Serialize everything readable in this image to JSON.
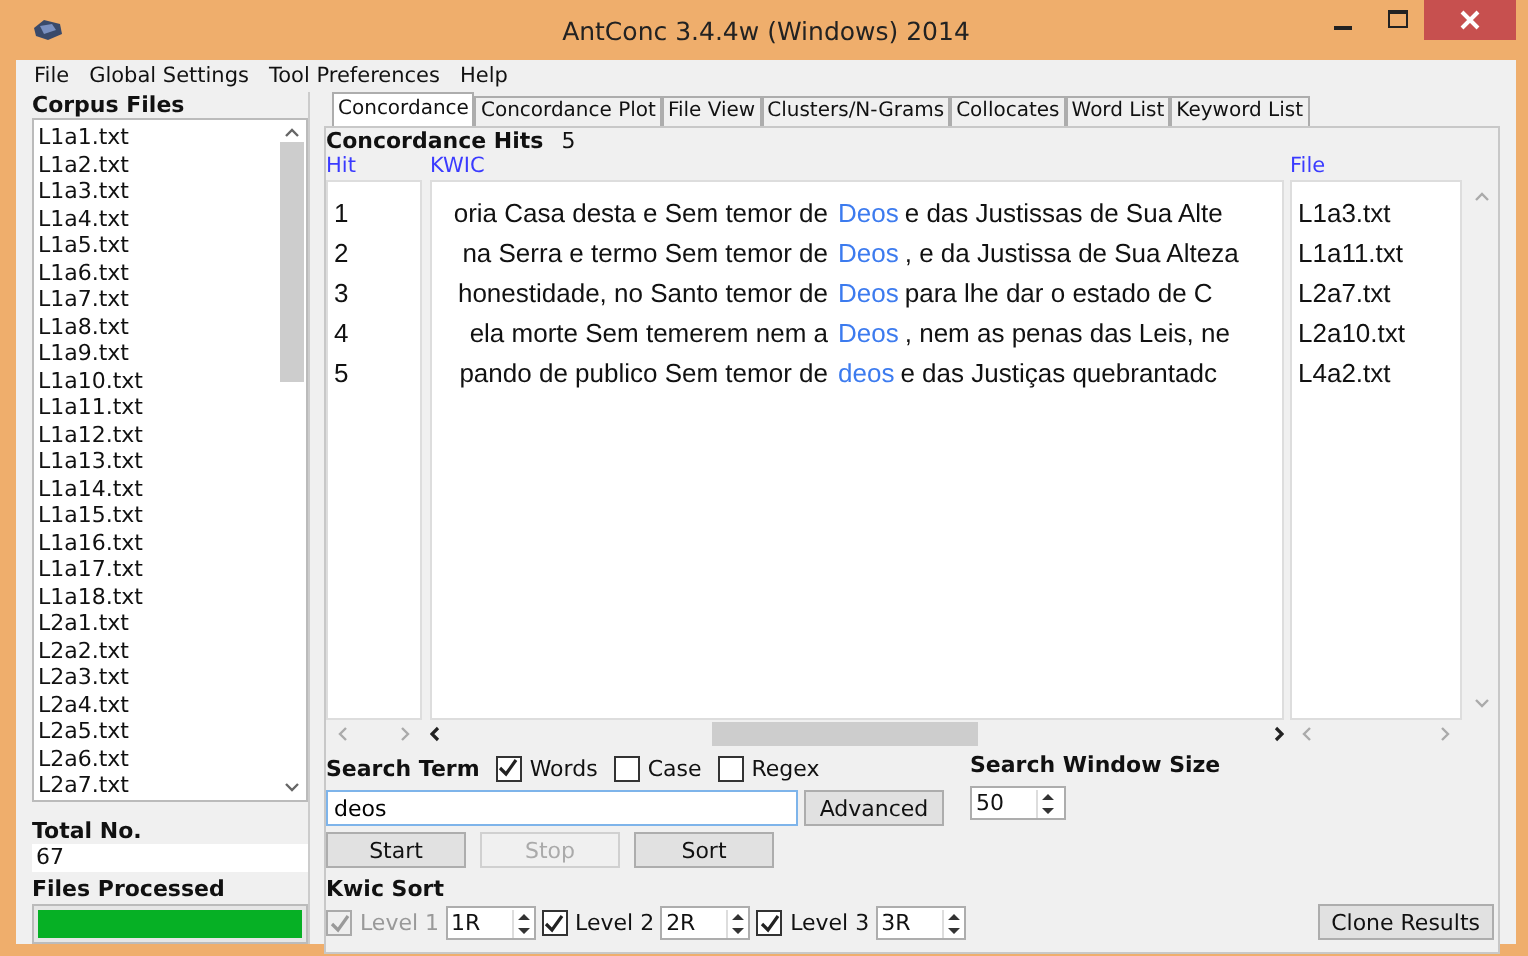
{
  "window": {
    "title": "AntConc 3.4.4w (Windows) 2014"
  },
  "menu": [
    "File",
    "Global Settings",
    "Tool Preferences",
    "Help"
  ],
  "corpus_files": {
    "title": "Corpus Files",
    "items": [
      "L1a1.txt",
      "L1a2.txt",
      "L1a3.txt",
      "L1a4.txt",
      "L1a5.txt",
      "L1a6.txt",
      "L1a7.txt",
      "L1a8.txt",
      "L1a9.txt",
      "L1a10.txt",
      "L1a11.txt",
      "L1a12.txt",
      "L1a13.txt",
      "L1a14.txt",
      "L1a15.txt",
      "L1a16.txt",
      "L1a17.txt",
      "L1a18.txt",
      "L2a1.txt",
      "L2a2.txt",
      "L2a3.txt",
      "L2a4.txt",
      "L2a5.txt",
      "L2a6.txt",
      "L2a7.txt"
    ]
  },
  "total": {
    "label": "Total No.",
    "value": "67"
  },
  "files_processed": {
    "label": "Files Processed",
    "level": 1
  },
  "tabs": [
    {
      "label": "Concordance",
      "selected": true
    },
    {
      "label": "Concordance Plot",
      "selected": false
    },
    {
      "label": "File View",
      "selected": false
    },
    {
      "label": "Clusters/N-Grams",
      "selected": false
    },
    {
      "label": "Collocates",
      "selected": false
    },
    {
      "label": "Word List",
      "selected": false
    },
    {
      "label": "Keyword List",
      "selected": false
    }
  ],
  "hits": {
    "label": "Concordance Hits",
    "count": "5"
  },
  "table": {
    "columns": [
      "Hit",
      "KWIC",
      "File"
    ],
    "rows": [
      {
        "hit": "1",
        "left": "oria Casa desta e Sem temor de",
        "keyword": "Deos",
        "right": "e das Justissas de Sua Alte",
        "file": "L1a3.txt"
      },
      {
        "hit": "2",
        "left": "na Serra e termo Sem temor de",
        "keyword": "Deos",
        "right": ", e da Justissa de Sua Alteza",
        "file": "L1a11.txt"
      },
      {
        "hit": "3",
        "left": "honestidade, no Santo temor de",
        "keyword": "Deos",
        "right": "para lhe dar o estado de C",
        "file": "L2a7.txt"
      },
      {
        "hit": "4",
        "left": "ela morte Sem temerem nem a",
        "keyword": "Deos",
        "right": ", nem as penas das Leis, ne",
        "file": "L2a10.txt"
      },
      {
        "hit": "5",
        "left": "pando de publico Sem temor de",
        "keyword": "deos",
        "right": "e das Justiças quebrantadc",
        "file": "L4a2.txt"
      }
    ]
  },
  "search": {
    "label": "Search Term",
    "value": "deos",
    "options": [
      {
        "label": "Words",
        "checked": true
      },
      {
        "label": "Case",
        "checked": false
      },
      {
        "label": "Regex",
        "checked": false
      }
    ],
    "advanced": "Advanced"
  },
  "window_size": {
    "label": "Search Window Size",
    "value": "50"
  },
  "buttons": [
    {
      "label": "Start",
      "disabled": false
    },
    {
      "label": "Stop",
      "disabled": true
    },
    {
      "label": "Sort",
      "disabled": false
    }
  ],
  "kwic_sort": {
    "label": "Kwic Sort",
    "levels": [
      {
        "label": "Level 1",
        "checked": true,
        "disabled": true,
        "value": "1R"
      },
      {
        "label": "Level 2",
        "checked": true,
        "disabled": false,
        "value": "2R"
      },
      {
        "label": "Level 3",
        "checked": true,
        "disabled": false,
        "value": "3R"
      }
    ]
  },
  "clone": "Clone Results"
}
